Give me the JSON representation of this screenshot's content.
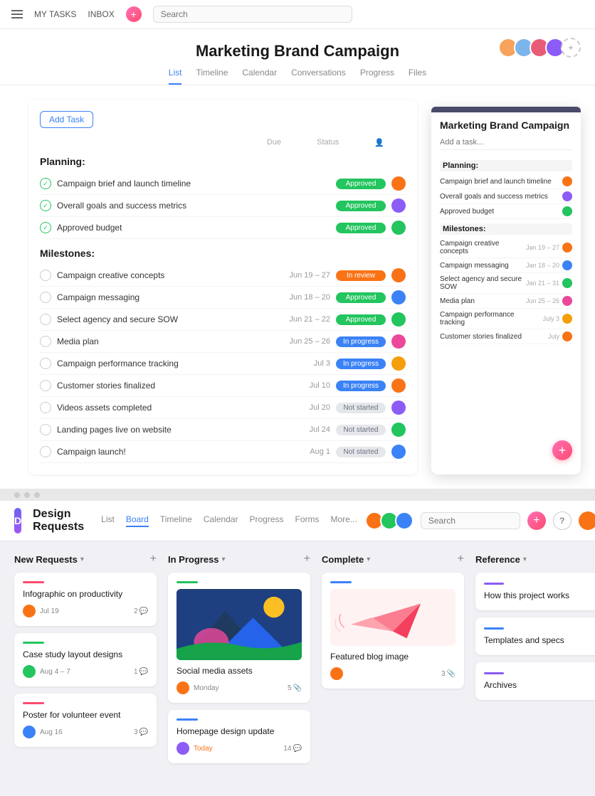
{
  "top_nav": {
    "my_tasks": "MY TASKS",
    "inbox": "INBOX",
    "search_placeholder": "Search"
  },
  "project": {
    "title": "Marketing Brand Campaign",
    "tabs": [
      "List",
      "Timeline",
      "Calendar",
      "Conversations",
      "Progress",
      "Files"
    ],
    "active_tab": "List",
    "add_task_label": "Add Task",
    "due_label": "Due",
    "status_label": "Status",
    "sections": [
      {
        "name": "Planning:",
        "tasks": [
          {
            "name": "Campaign brief and launch timeline",
            "date": "",
            "status": "Approved",
            "status_class": "badge-approved",
            "av_class": "ta1"
          },
          {
            "name": "Overall goals and success metrics",
            "date": "",
            "status": "Approved",
            "status_class": "badge-approved",
            "av_class": "ta2"
          },
          {
            "name": "Approved budget",
            "date": "",
            "status": "Approved",
            "status_class": "badge-approved",
            "av_class": "ta3"
          }
        ]
      },
      {
        "name": "Milestones:",
        "tasks": [
          {
            "name": "Campaign creative concepts",
            "date": "Jun 19 – 27",
            "status": "In review",
            "status_class": "badge-in-review",
            "av_class": "ta1"
          },
          {
            "name": "Campaign messaging",
            "date": "Jun 18 – 20",
            "status": "Approved",
            "status_class": "badge-approved",
            "av_class": "ta4"
          },
          {
            "name": "Select agency and secure SOW",
            "date": "Jun 21 – 22",
            "status": "Approved",
            "status_class": "badge-approved",
            "av_class": "ta3"
          },
          {
            "name": "Media plan",
            "date": "Jun 25 – 26",
            "status": "In progress",
            "status_class": "badge-in-progress",
            "av_class": "ta5"
          },
          {
            "name": "Campaign performance tracking",
            "date": "Jul 3",
            "status": "In progress",
            "status_class": "badge-in-progress",
            "av_class": "ta6"
          },
          {
            "name": "Customer stories finalized",
            "date": "Jul 10",
            "status": "In progress",
            "status_class": "badge-in-progress",
            "av_class": "ta1"
          },
          {
            "name": "Videos assets completed",
            "date": "Jul 20",
            "status": "Not started",
            "status_class": "badge-not-started",
            "av_class": "ta2"
          },
          {
            "name": "Landing pages live on website",
            "date": "Jul 24",
            "status": "Not started",
            "status_class": "badge-not-started",
            "av_class": "ta3"
          },
          {
            "name": "Campaign launch!",
            "date": "Aug 1",
            "status": "Not started",
            "status_class": "badge-not-started",
            "av_class": "ta4"
          }
        ]
      }
    ]
  },
  "side_panel": {
    "title": "Marketing Brand Campaign",
    "input_placeholder": "Add a task...",
    "sections": [
      {
        "name": "Planning:",
        "tasks": [
          {
            "name": "Campaign brief and launch timeline",
            "date": "",
            "av_class": "ta1"
          },
          {
            "name": "Overall goals and success metrics",
            "date": "",
            "av_class": "ta2"
          },
          {
            "name": "Approved budget",
            "date": "",
            "av_class": "ta3"
          }
        ]
      },
      {
        "name": "Milestones:",
        "tasks": [
          {
            "name": "Campaign creative concepts",
            "date": "Jan 19 – 27",
            "av_class": "ta1"
          },
          {
            "name": "Campaign messaging",
            "date": "Jan 18 – 20",
            "av_class": "ta4"
          },
          {
            "name": "Select agency and secure SOW",
            "date": "Jan 21 – 31",
            "av_class": "ta3"
          },
          {
            "name": "Media plan",
            "date": "Jun 25 – 26",
            "av_class": "ta5"
          },
          {
            "name": "Campaign performance tracking",
            "date": "July 3",
            "av_class": "ta6"
          },
          {
            "name": "Customer stories finalized",
            "date": "July",
            "av_class": "ta1"
          }
        ]
      }
    ]
  },
  "bottom": {
    "logo_text": "D",
    "project_title": "Design Requests",
    "tabs": [
      "List",
      "Board",
      "Timeline",
      "Calendar",
      "Progress",
      "Forms",
      "More..."
    ],
    "active_tab": "Board",
    "search_placeholder": "Search",
    "help_label": "?",
    "columns": [
      {
        "id": "new-requests",
        "title": "New Requests",
        "cards": [
          {
            "id": "infographic",
            "color": "#ff4b6e",
            "title": "Infographic on productivity",
            "date": "Jul 19",
            "av_class": "cav1",
            "count": "2",
            "count_type": "comment"
          },
          {
            "id": "case-study",
            "color": "#22c55e",
            "title": "Case study layout designs",
            "date": "Aug 4 – 7",
            "av_class": "cav2",
            "count": "1",
            "count_type": "comment"
          },
          {
            "id": "poster",
            "color": "#ff4b6e",
            "title": "Poster for volunteer event",
            "date": "Aug 16",
            "av_class": "cav3",
            "count": "3",
            "count_type": "comment"
          }
        ]
      },
      {
        "id": "in-progress",
        "title": "In Progress",
        "cards": [
          {
            "id": "social-media",
            "color": "#22c55e",
            "title": "Social media assets",
            "date": "Monday",
            "date_color": "#1a1a1a",
            "av_class": "cav1",
            "count": "5",
            "count_type": "attach",
            "has_image": true,
            "image_type": "mountain"
          },
          {
            "id": "homepage",
            "color": "#3b82f6",
            "title": "Homepage design update",
            "date": "Today",
            "date_color": "#f97316",
            "av_class": "cav4",
            "count": "14",
            "count_type": "comment"
          }
        ]
      },
      {
        "id": "complete",
        "title": "Complete",
        "cards": [
          {
            "id": "featured-blog",
            "color": "#3b82f6",
            "title": "Featured blog image",
            "date": "",
            "av_class": "cav1",
            "count": "3",
            "count_type": "attach",
            "has_image": true,
            "image_type": "paper-plane"
          }
        ]
      },
      {
        "id": "reference",
        "title": "Reference",
        "ref_cards": [
          {
            "id": "how-this",
            "color": "#8b5cf6",
            "title": "How this project works"
          },
          {
            "id": "templates",
            "color": "#3b82f6",
            "title": "Templates and specs"
          },
          {
            "id": "archives",
            "color": "#8b5cf6",
            "title": "Archives"
          }
        ]
      }
    ]
  },
  "dots": [
    "●",
    "●",
    "●"
  ]
}
